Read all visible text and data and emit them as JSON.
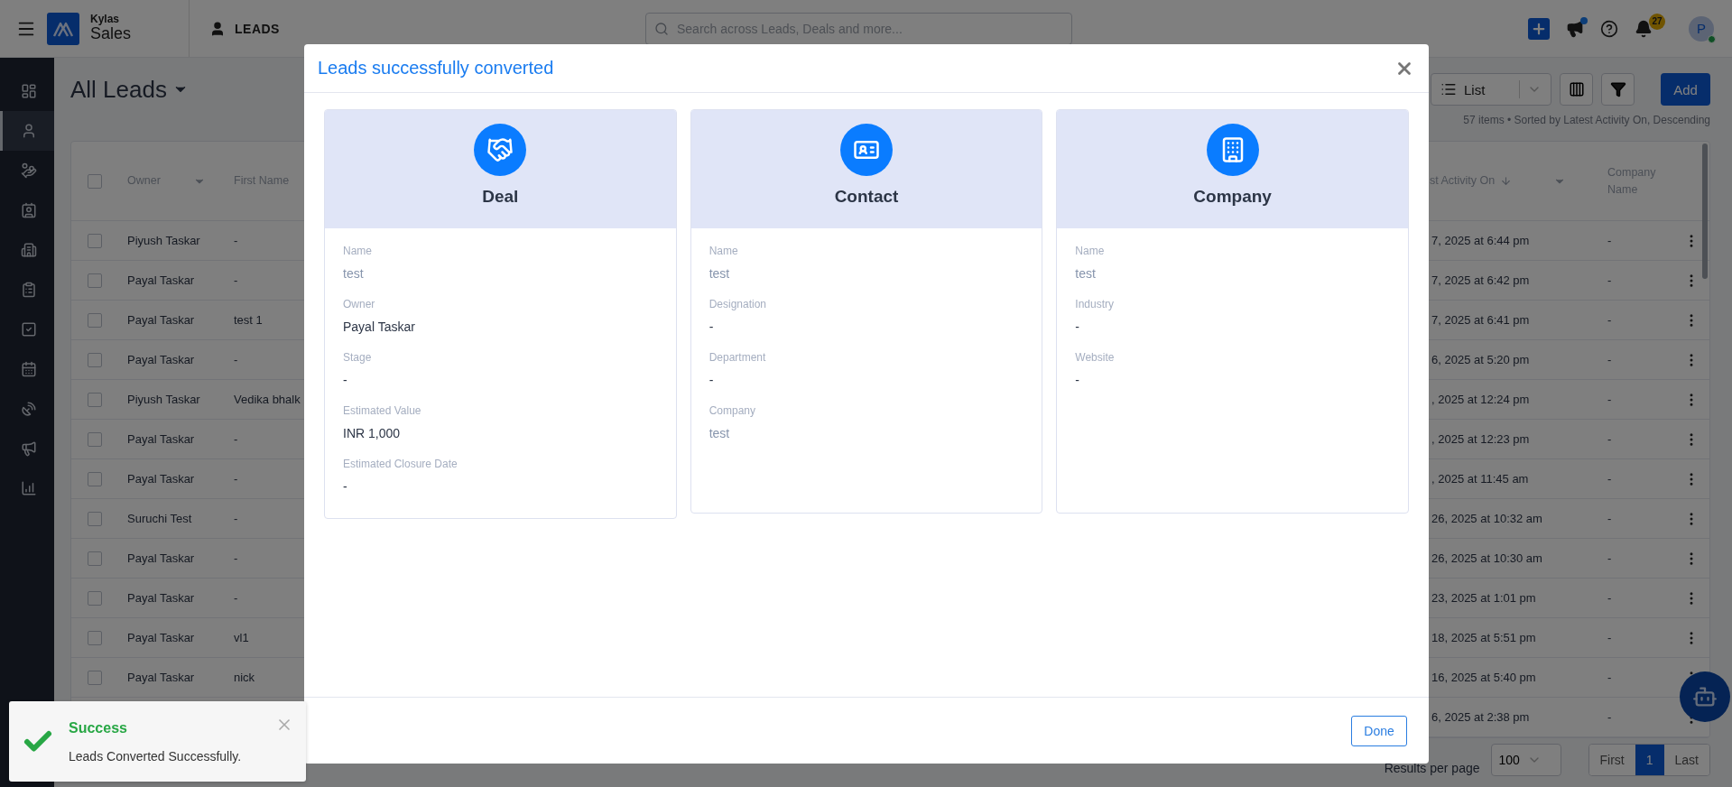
{
  "topbar": {
    "brand_top": "Kylas",
    "brand_bottom": "Sales",
    "module": "LEADS",
    "search": {
      "placeholder": "Search across Leads, Deals and more..."
    },
    "announcement_unread": true,
    "notifications_count": "27",
    "avatar_initial": "P",
    "online": true
  },
  "sidebar": {
    "items": [
      {
        "kind": "dashboard",
        "selected": false
      },
      {
        "kind": "leads",
        "selected": true
      },
      {
        "kind": "deals",
        "selected": false
      },
      {
        "kind": "contacts",
        "selected": false
      },
      {
        "kind": "companies",
        "selected": false
      },
      {
        "kind": "quotes",
        "selected": false
      },
      {
        "kind": "tasks",
        "selected": false
      },
      {
        "kind": "calendar",
        "selected": false
      },
      {
        "kind": "calls",
        "selected": false
      },
      {
        "kind": "campaigns",
        "selected": false
      },
      {
        "kind": "reports",
        "selected": false
      }
    ]
  },
  "page": {
    "title": "All Leads",
    "view": "List",
    "add_button": "Add",
    "summary": "57 items • Sorted by Latest Activity On, Descending"
  },
  "table": {
    "all_checked": false,
    "columns": [
      "Owner",
      "First Name",
      "st Activity On",
      "Company Name"
    ],
    "rows": [
      {
        "checked": false,
        "owner": "Piyush Taskar",
        "first_name": "-",
        "last_activity": "7, 2025 at 6:44 pm",
        "company_name": "-"
      },
      {
        "checked": false,
        "owner": "Payal Taskar",
        "first_name": "-",
        "last_activity": "7, 2025 at 6:42 pm",
        "company_name": "-"
      },
      {
        "checked": false,
        "owner": "Payal Taskar",
        "first_name": "test 1",
        "last_activity": "7, 2025 at 6:41 pm",
        "company_name": "-"
      },
      {
        "checked": false,
        "owner": "Payal Taskar",
        "first_name": "-",
        "last_activity": "6, 2025 at 5:20 pm",
        "company_name": "-"
      },
      {
        "checked": false,
        "owner": "Piyush Taskar",
        "first_name": "Vedika bhalk",
        "last_activity": ", 2025 at 12:24 pm",
        "company_name": "-"
      },
      {
        "checked": false,
        "owner": "Payal Taskar",
        "first_name": "-",
        "last_activity": ", 2025 at 12:23 pm",
        "company_name": "-"
      },
      {
        "checked": false,
        "owner": "Payal Taskar",
        "first_name": "-",
        "last_activity": ", 2025 at 11:45 am",
        "company_name": "-"
      },
      {
        "checked": false,
        "owner": "Suruchi Test",
        "first_name": "-",
        "last_activity": "26, 2025 at 10:32 am",
        "company_name": "-"
      },
      {
        "checked": false,
        "owner": "Payal Taskar",
        "first_name": "-",
        "last_activity": "26, 2025 at 10:30 am",
        "company_name": "-"
      },
      {
        "checked": false,
        "owner": "Payal Taskar",
        "first_name": "-",
        "last_activity": "23, 2025 at 1:01 pm",
        "company_name": "-"
      },
      {
        "checked": false,
        "owner": "Payal Taskar",
        "first_name": "vl1",
        "last_activity": "18, 2025 at 5:51 pm",
        "company_name": "-"
      },
      {
        "checked": false,
        "owner": "Payal Taskar",
        "first_name": "nick",
        "last_activity": "16, 2025 at 5:40 pm",
        "company_name": "-"
      },
      {
        "last_activity": "6, 2025 at 2:38 pm",
        "company_name": "-"
      }
    ]
  },
  "pagination": {
    "label": "Results per page",
    "per_page": "100",
    "first": "First",
    "pages": [
      {
        "label": "1",
        "selected": true
      }
    ],
    "last": "Last"
  },
  "modal": {
    "title": "Leads successfully converted",
    "done_button": "Done",
    "cards": [
      {
        "kind": "deal",
        "title": "Deal",
        "fields": [
          {
            "label": "Name",
            "value": "test",
            "muted": true
          },
          {
            "label": "Owner",
            "value": "Payal Taskar",
            "muted": false
          },
          {
            "label": "Stage",
            "value": "-",
            "muted": false
          },
          {
            "label": "Estimated Value",
            "value": "INR 1,000",
            "muted": false
          },
          {
            "label": "Estimated Closure Date",
            "value": "-",
            "muted": false
          }
        ]
      },
      {
        "kind": "contact",
        "title": "Contact",
        "fields": [
          {
            "label": "Name",
            "value": "test",
            "muted": true
          },
          {
            "label": "Designation",
            "value": "-",
            "muted": false
          },
          {
            "label": "Department",
            "value": "-",
            "muted": false
          },
          {
            "label": "Company",
            "value": "test",
            "muted": true
          }
        ]
      },
      {
        "kind": "company",
        "title": "Company",
        "fields": [
          {
            "label": "Name",
            "value": "test",
            "muted": true
          },
          {
            "label": "Industry",
            "value": "-",
            "muted": false
          },
          {
            "label": "Website",
            "value": "-",
            "muted": false
          }
        ]
      }
    ]
  },
  "toast": {
    "kind": "success",
    "title": "Success",
    "message": "Leads Converted Successfully."
  }
}
